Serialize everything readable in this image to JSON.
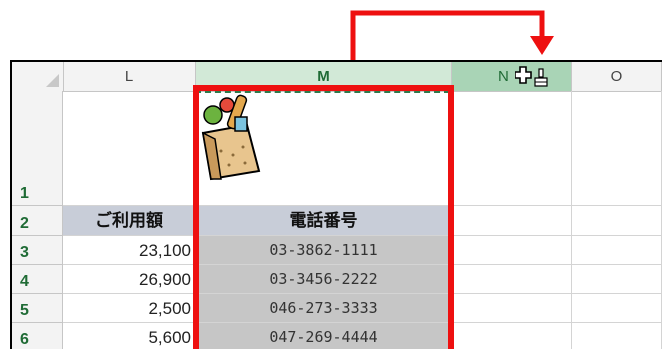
{
  "columns": {
    "l": "L",
    "m": "M",
    "n": "N",
    "o": "O"
  },
  "rows": [
    "1",
    "2",
    "3",
    "4",
    "5",
    "6"
  ],
  "table": {
    "header_amount": "ご利用額",
    "header_phone": "電話番号",
    "amounts": [
      "23,100",
      "26,900",
      "2,500",
      "5,600"
    ],
    "phones": [
      "03-3862-1111",
      "03-3456-2222",
      "046-273-3333",
      "047-269-4444"
    ]
  },
  "annotation": {
    "color": "#ee1010"
  },
  "icons": {
    "cursor": "format-painter-cursor-icon",
    "picture": "shopping-bag-icon",
    "corner": "select-all-triangle-icon"
  }
}
